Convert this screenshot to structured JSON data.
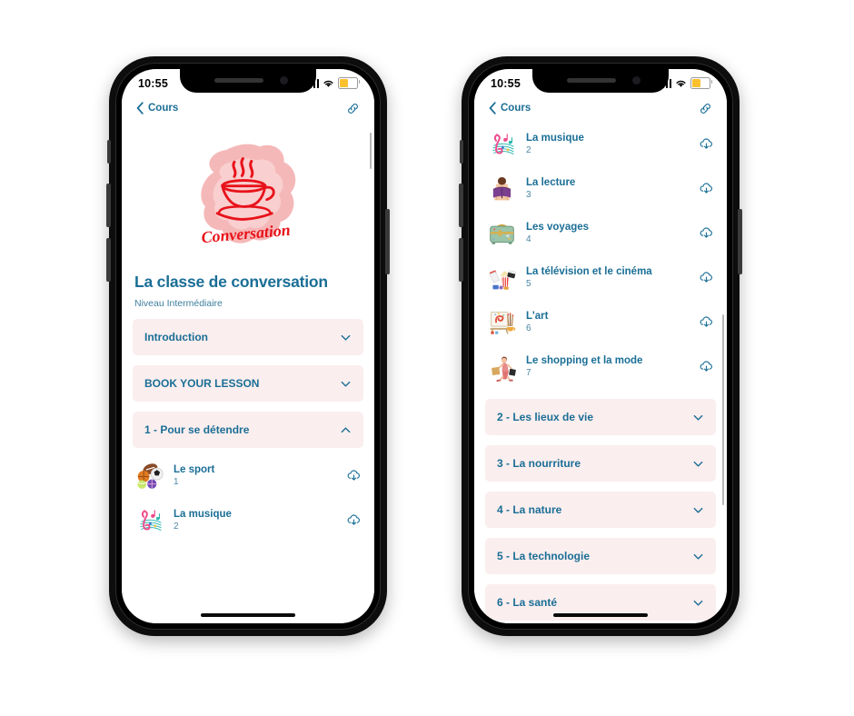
{
  "statusbar": {
    "time": "10:55",
    "signal_icon": "cellular-bars-icon",
    "wifi_icon": "wifi-icon",
    "battery_icon": "battery-low-power-icon",
    "battery_color": "#fbc02d"
  },
  "navbar": {
    "back_label": "Cours",
    "back_icon": "chevron-left-icon",
    "link_icon": "link-icon"
  },
  "theme": {
    "accent": "#1a6e96",
    "accordion_bg": "#fbeeee",
    "logo_red": "#e8121a",
    "logo_splash": "#f3a0a0"
  },
  "logo": {
    "alt": "conversation-coffee-cup-logo",
    "script_text": "Conversation"
  },
  "course": {
    "title": "La classe de conversation",
    "subtitle": "Niveau Intermédiaire"
  },
  "left_phone": {
    "accordions": [
      {
        "label": "Introduction",
        "expanded": false,
        "chevron": "chevron-down-icon"
      },
      {
        "label": "BOOK YOUR LESSON",
        "expanded": false,
        "chevron": "chevron-down-icon"
      },
      {
        "label": "1 - Pour se détendre",
        "expanded": true,
        "chevron": "chevron-up-icon"
      }
    ],
    "lessons": [
      {
        "name": "Le sport",
        "number": "1",
        "thumb": "sports-balls-thumb",
        "action_icon": "cloud-download-icon"
      },
      {
        "name": "La musique",
        "number": "2",
        "thumb": "music-notes-thumb",
        "action_icon": "cloud-download-icon"
      }
    ]
  },
  "right_phone": {
    "lessons": [
      {
        "name": "La musique",
        "number": "2",
        "thumb": "music-notes-thumb",
        "action_icon": "cloud-download-icon"
      },
      {
        "name": "La lecture",
        "number": "3",
        "thumb": "reading-person-thumb",
        "action_icon": "cloud-download-icon"
      },
      {
        "name": "Les voyages",
        "number": "4",
        "thumb": "suitcase-thumb",
        "action_icon": "cloud-download-icon"
      },
      {
        "name": "La télévision et le cinéma",
        "number": "5",
        "thumb": "cinema-popcorn-thumb",
        "action_icon": "cloud-download-icon"
      },
      {
        "name": "L'art",
        "number": "6",
        "thumb": "art-easel-thumb",
        "action_icon": "cloud-download-icon"
      },
      {
        "name": "Le shopping et la mode",
        "number": "7",
        "thumb": "shopping-woman-thumb",
        "action_icon": "cloud-download-icon"
      }
    ],
    "accordions": [
      {
        "label": "2 - Les lieux de vie",
        "expanded": false,
        "chevron": "chevron-down-icon"
      },
      {
        "label": "3 - La nourriture",
        "expanded": false,
        "chevron": "chevron-down-icon"
      },
      {
        "label": "4 - La nature",
        "expanded": false,
        "chevron": "chevron-down-icon"
      },
      {
        "label": "5 - La technologie",
        "expanded": false,
        "chevron": "chevron-down-icon"
      },
      {
        "label": "6 - La santé",
        "expanded": false,
        "chevron": "chevron-down-icon"
      }
    ]
  }
}
